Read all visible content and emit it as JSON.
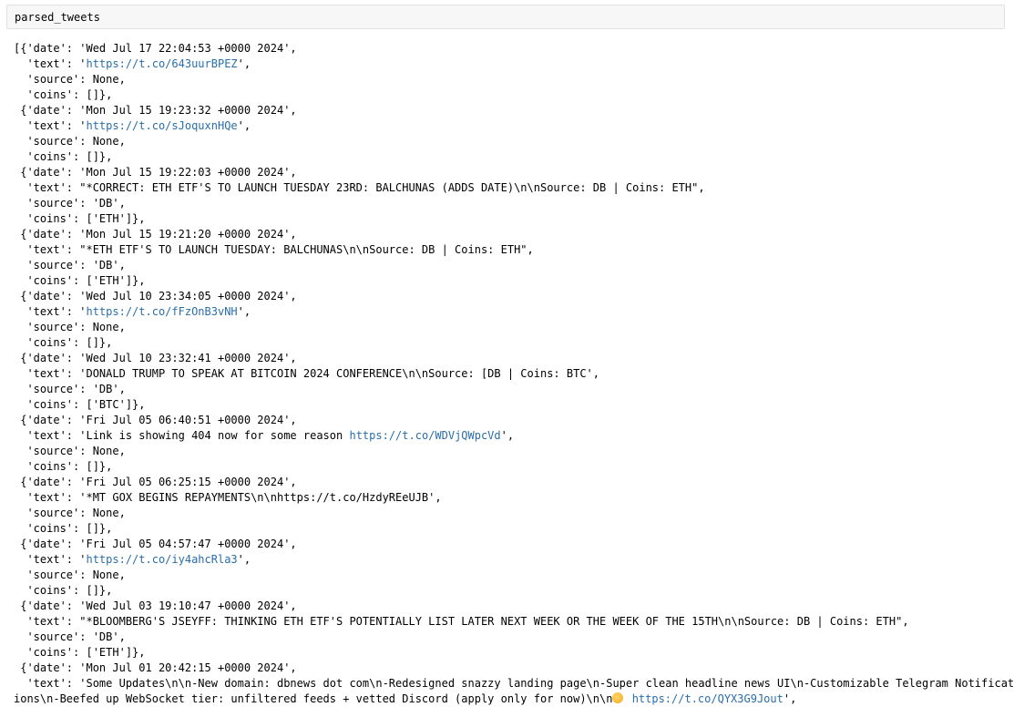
{
  "input_cell": {
    "code": "parsed_tweets"
  },
  "output": {
    "lines": [
      [
        {
          "t": "[{'date': 'Wed Jul 17 22:04:53 +0000 2024',"
        }
      ],
      [
        {
          "t": "  'text': '"
        },
        {
          "t": "https://t.co/643uurBPEZ",
          "link": true
        },
        {
          "t": "',"
        }
      ],
      [
        {
          "t": "  'source': None,"
        }
      ],
      [
        {
          "t": "  'coins': []},"
        }
      ],
      [
        {
          "t": " {'date': 'Mon Jul 15 19:23:32 +0000 2024',"
        }
      ],
      [
        {
          "t": "  'text': '"
        },
        {
          "t": "https://t.co/sJoquxnHQe",
          "link": true
        },
        {
          "t": "',"
        }
      ],
      [
        {
          "t": "  'source': None,"
        }
      ],
      [
        {
          "t": "  'coins': []},"
        }
      ],
      [
        {
          "t": " {'date': 'Mon Jul 15 19:22:03 +0000 2024',"
        }
      ],
      [
        {
          "t": "  'text': \"*CORRECT: ETH ETF'S TO LAUNCH TUESDAY 23RD: BALCHUNAS (ADDS DATE)\\n\\nSource: DB | Coins: ETH\","
        }
      ],
      [
        {
          "t": "  'source': 'DB',"
        }
      ],
      [
        {
          "t": "  'coins': ['ETH']},"
        }
      ],
      [
        {
          "t": " {'date': 'Mon Jul 15 19:21:20 +0000 2024',"
        }
      ],
      [
        {
          "t": "  'text': \"*ETH ETF'S TO LAUNCH TUESDAY: BALCHUNAS\\n\\nSource: DB | Coins: ETH\","
        }
      ],
      [
        {
          "t": "  'source': 'DB',"
        }
      ],
      [
        {
          "t": "  'coins': ['ETH']},"
        }
      ],
      [
        {
          "t": " {'date': 'Wed Jul 10 23:34:05 +0000 2024',"
        }
      ],
      [
        {
          "t": "  'text': '"
        },
        {
          "t": "https://t.co/fFzOnB3vNH",
          "link": true
        },
        {
          "t": "',"
        }
      ],
      [
        {
          "t": "  'source': None,"
        }
      ],
      [
        {
          "t": "  'coins': []},"
        }
      ],
      [
        {
          "t": " {'date': 'Wed Jul 10 23:32:41 +0000 2024',"
        }
      ],
      [
        {
          "t": "  'text': 'DONALD TRUMP TO SPEAK AT BITCOIN 2024 CONFERENCE\\n\\nSource: [DB | Coins: BTC',"
        }
      ],
      [
        {
          "t": "  'source': 'DB',"
        }
      ],
      [
        {
          "t": "  'coins': ['BTC']},"
        }
      ],
      [
        {
          "t": " {'date': 'Fri Jul 05 06:40:51 +0000 2024',"
        }
      ],
      [
        {
          "t": "  'text': 'Link is showing 404 now for some reason "
        },
        {
          "t": "https://t.co/WDVjQWpcVd",
          "link": true
        },
        {
          "t": "',"
        }
      ],
      [
        {
          "t": "  'source': None,"
        }
      ],
      [
        {
          "t": "  'coins': []},"
        }
      ],
      [
        {
          "t": " {'date': 'Fri Jul 05 06:25:15 +0000 2024',"
        }
      ],
      [
        {
          "t": "  'text': '*MT GOX BEGINS REPAYMENTS\\n\\nhttps://t.co/HzdyREeUJB',"
        }
      ],
      [
        {
          "t": "  'source': None,"
        }
      ],
      [
        {
          "t": "  'coins': []},"
        }
      ],
      [
        {
          "t": " {'date': 'Fri Jul 05 04:57:47 +0000 2024',"
        }
      ],
      [
        {
          "t": "  'text': '"
        },
        {
          "t": "https://t.co/iy4ahcRla3",
          "link": true
        },
        {
          "t": "',"
        }
      ],
      [
        {
          "t": "  'source': None,"
        }
      ],
      [
        {
          "t": "  'coins': []},"
        }
      ],
      [
        {
          "t": " {'date': 'Wed Jul 03 19:10:47 +0000 2024',"
        }
      ],
      [
        {
          "t": "  'text': \"*BLOOMBERG'S JSEYFF: THINKING ETH ETF'S POTENTIALLY LIST LATER NEXT WEEK OR THE WEEK OF THE 15TH\\n\\nSource: DB | Coins: ETH\","
        }
      ],
      [
        {
          "t": "  'source': 'DB',"
        }
      ],
      [
        {
          "t": "  'coins': ['ETH']},"
        }
      ],
      [
        {
          "t": " {'date': 'Mon Jul 01 20:42:15 +0000 2024',"
        }
      ],
      [
        {
          "t": "  'text': 'Some Updates\\n\\n-New domain: dbnews dot com\\n-Redesigned snazzy landing page\\n-Super clean headline news UI\\n-Customizable Telegram Notificat"
        }
      ],
      [
        {
          "t": "ions\\n-Beefed up WebSocket tier: unfiltered feeds + vetted Discord (apply only for now)\\n\\n"
        },
        {
          "emoji": "smiling-face-emoji"
        },
        {
          "t": " "
        },
        {
          "t": "https://t.co/QYX3G9Jout",
          "link": true
        },
        {
          "t": "',"
        }
      ]
    ]
  }
}
